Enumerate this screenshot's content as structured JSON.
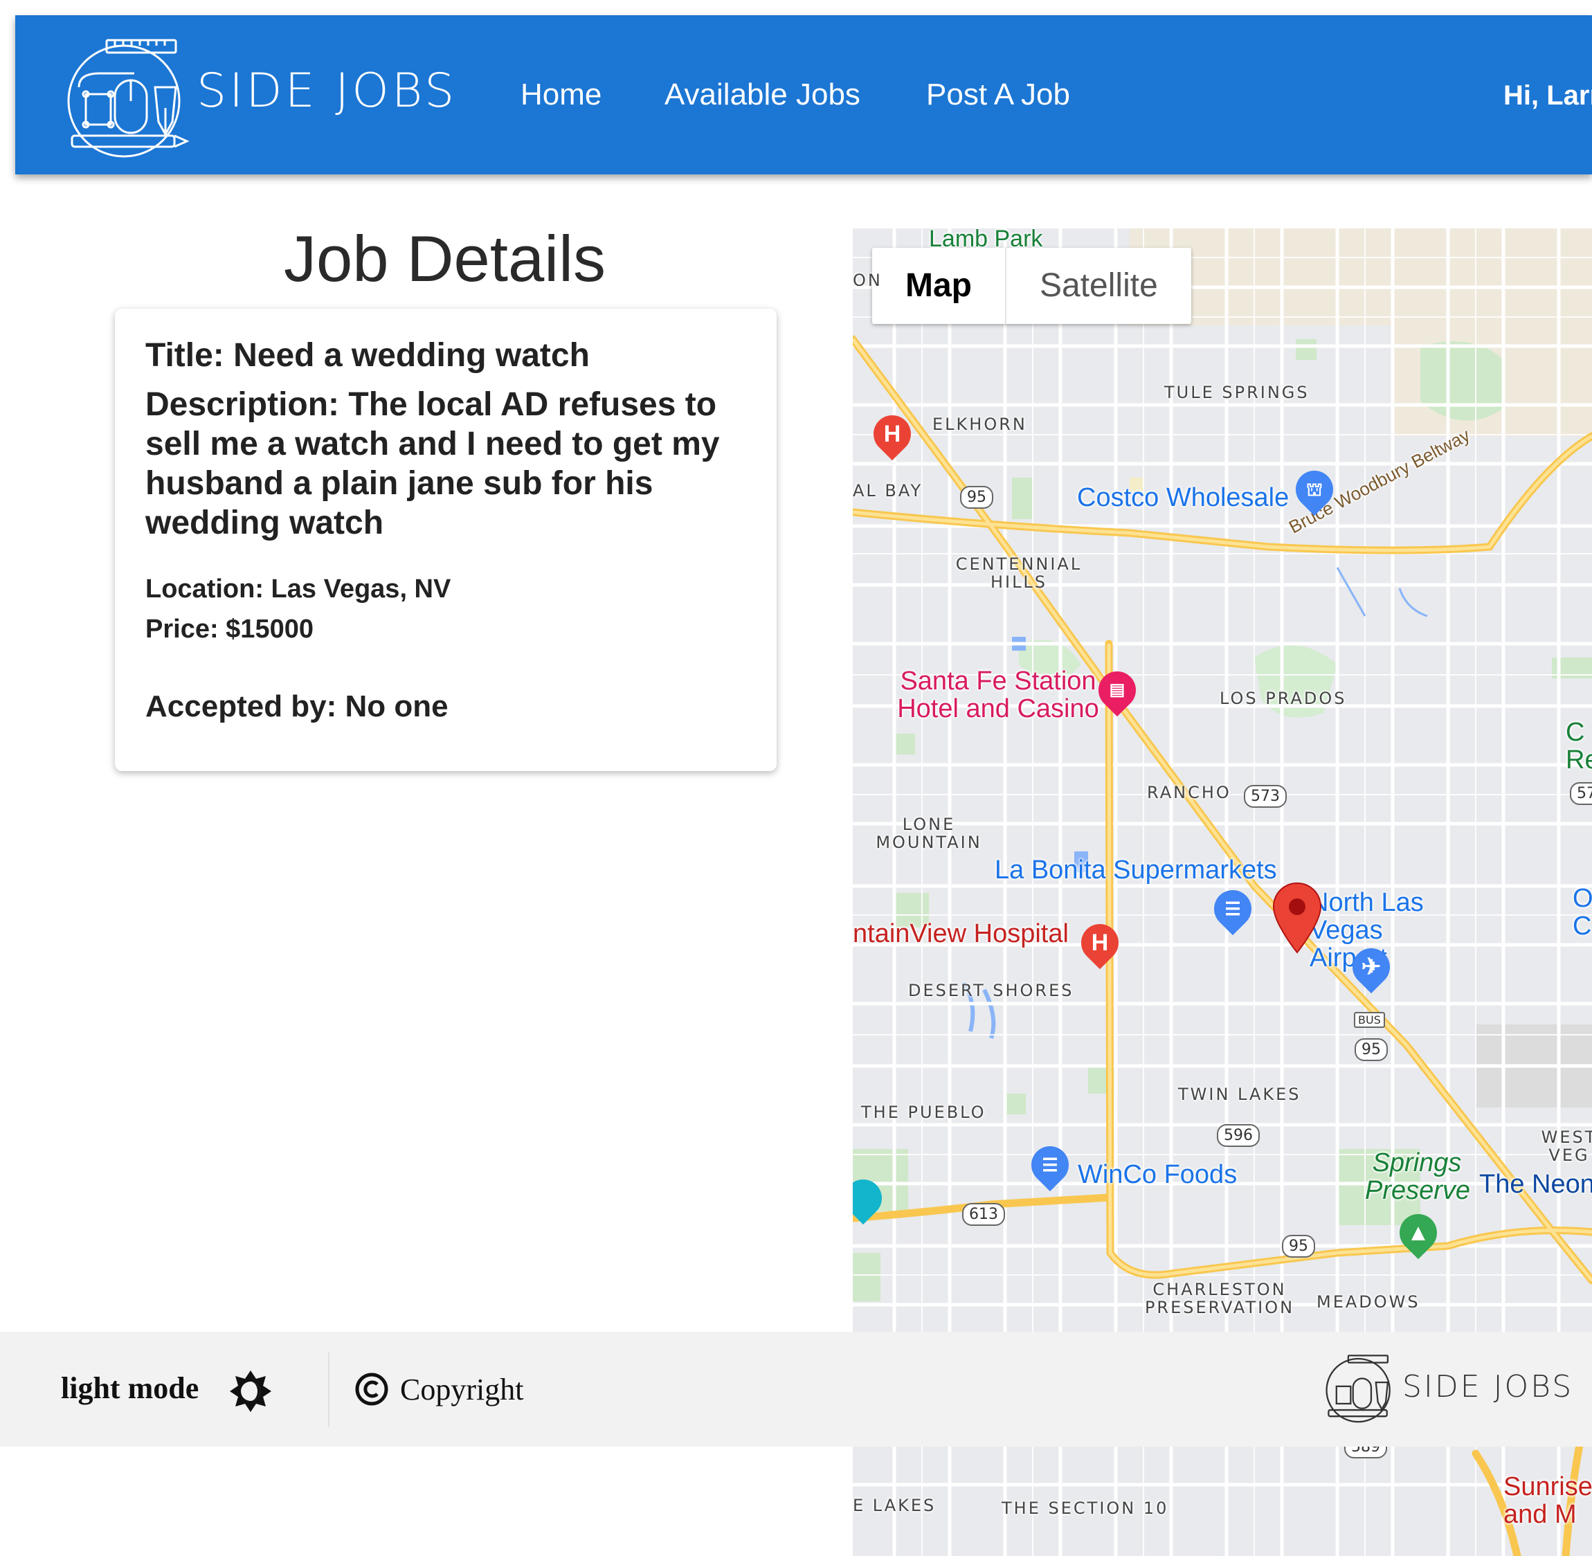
{
  "nav": {
    "brand": "SIDE JOBS",
    "links": [
      "Home",
      "Available Jobs",
      "Post A Job"
    ],
    "greeting": "Hi, Larr"
  },
  "page": {
    "title": "Job Details"
  },
  "job": {
    "title_line": "Title: Need a wedding watch",
    "description_line": "Description: The local AD refuses to sell me a watch and I need to get my husband a plain jane sub for his wedding watch",
    "location_line": "Location: Las Vegas, NV",
    "price_line": "Price: $15000",
    "accepted_line": "Accepted by: No one"
  },
  "map": {
    "toggle": {
      "map": "Map",
      "satellite": "Satellite"
    },
    "area_labels": {
      "lamb_park": "Lamb Park",
      "tule_springs": "TULE SPRINGS",
      "elkhorn": "ELKHORN",
      "al_bay": "AL BAY",
      "centennial_hills": "CENTENNIAL HILLS",
      "los_prados": "LOS PRADOS",
      "rancho": "RANCHO",
      "lone_mountain": "LONE MOUNTAIN",
      "desert_shores": "DESERT SHORES",
      "the_pueblo": "THE PUEBLO",
      "twin_lakes": "TWIN LAKES",
      "charleston_preservation": "CHARLESTON PRESERVATION",
      "meadows": "MEADOWS",
      "west_veg": "WEST VEG",
      "lakes": "E LAKES",
      "the_section_10": "THE SECTION 10",
      "on": "ON"
    },
    "place_labels": {
      "costco": "Costco Wholesale",
      "beltway": "Bruce Woodbury Beltway",
      "santa_fe": "Santa Fe Station Hotel and Casino",
      "la_bonita": "La Bonita Supermarkets",
      "airport": "North Las Vegas Airport",
      "hospital": "ntainView Hospital",
      "winco": "WinCo Foods",
      "springs": "Springs Preserve",
      "neon": "The Neon",
      "sunrise": "Sunrise and M",
      "c_re": "C Re",
      "o_c": "O C"
    },
    "shields": [
      "95",
      "573",
      "596",
      "613",
      "95",
      "95",
      "589",
      "57",
      "BUS"
    ]
  },
  "footer": {
    "mode_label": "light mode",
    "copyright": "Copyright",
    "brand": "SIDE JOBS"
  },
  "colors": {
    "nav": "#1c76d3",
    "map_bg": "#e8eaed",
    "pin_red": "#ea4335"
  }
}
